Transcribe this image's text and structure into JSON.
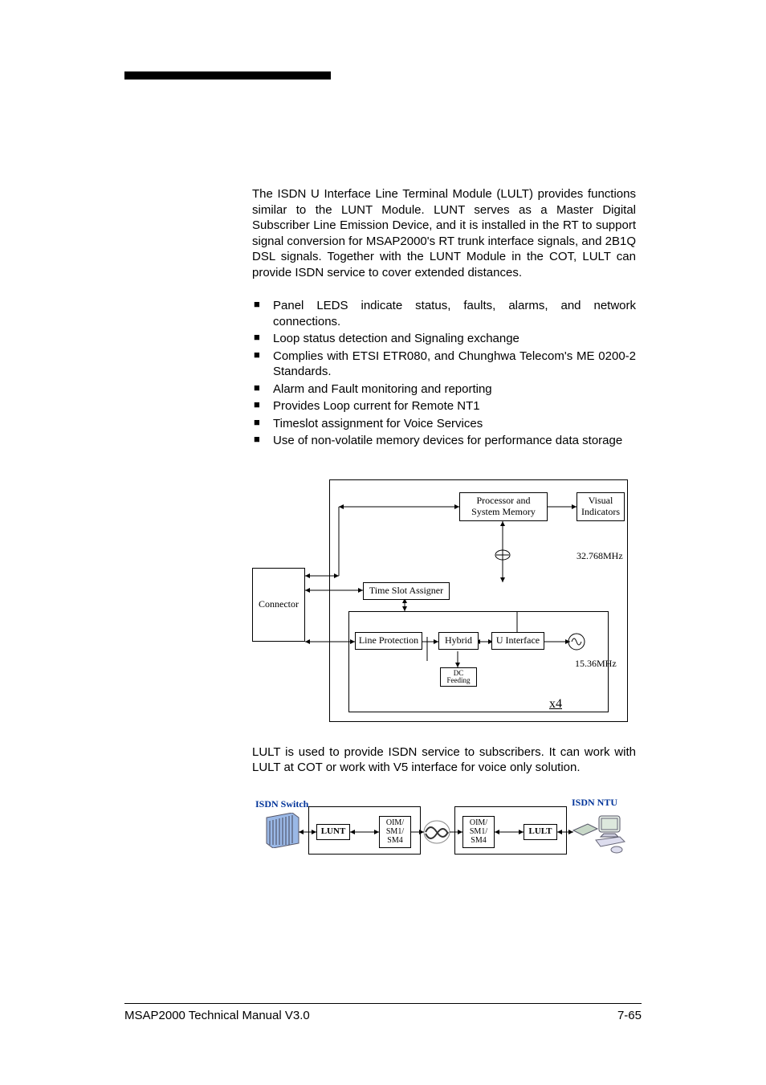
{
  "intro_paragraph": "The ISDN U Interface Line Terminal Module (LULT) provides functions similar to the LUNT Module.  LUNT serves as a Master Digital Subscriber Line Emission Device, and it is installed in the RT to support signal conversion for MSAP2000's RT trunk interface signals, and 2B1Q DSL signals.   Together with the LUNT Module in the COT, LULT can provide ISDN service to cover extended distances.",
  "features": [
    "Panel LEDS indicate status, faults, alarms, and network connections.",
    "Loop status detection and Signaling exchange",
    "Complies with ETSI ETR080, and Chunghwa Telecom's ME 0200-2 Standards.",
    "Alarm and Fault monitoring and reporting",
    "Provides Loop current for Remote NT1",
    "Timeslot assignment for Voice Services",
    "Use of non-volatile memory devices for performance data storage"
  ],
  "diagram1": {
    "connector": "Connector",
    "processor": "Processor and System Memory",
    "visual": "Visual Indicators",
    "freq1": "32.768MHz",
    "timeslot": "Time Slot Assigner",
    "line_protection": "Line Protection",
    "hybrid": "Hybrid",
    "u_interface": "U Interface",
    "dc_feeding": "DC Feeding",
    "freq2": "15.36MHz",
    "x4": "x4"
  },
  "mid_paragraph": "LULT is used to provide ISDN service to subscribers. It can work with LULT at COT or work with V5 interface for voice only solution.",
  "diagram2": {
    "isdn_switch": "ISDN Switch",
    "lunt": "LUNT",
    "oim": "OIM/ SM1/ SM4",
    "lult": "LULT",
    "isdn_ntu": "ISDN NTU"
  },
  "footer": {
    "left": "MSAP2000 Technical Manual V3.0",
    "right": "7-65"
  }
}
